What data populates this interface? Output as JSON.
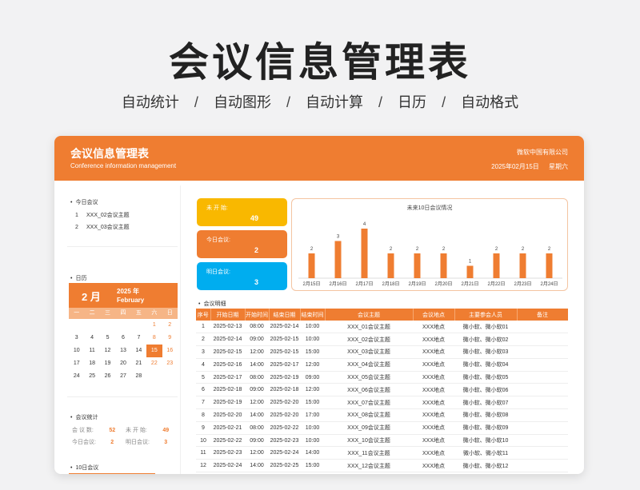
{
  "hero": {
    "title": "会议信息管理表",
    "tags": [
      "自动统计",
      "自动图形",
      "自动计算",
      "日历",
      "自动格式"
    ],
    "separator": "/"
  },
  "header": {
    "title": "会议信息管理表",
    "subtitle": "Conference information management",
    "company": "微软中国有限公司",
    "date": "2025年02月15日",
    "weekday": "星期六"
  },
  "today_meetings": {
    "title": "今日会议",
    "items": [
      {
        "n": "1",
        "name": "XXX_02会议主题"
      },
      {
        "n": "2",
        "name": "XXX_03会议主题"
      }
    ]
  },
  "calendar": {
    "title": "日历",
    "month": "2 月",
    "year": "2025 年",
    "month_en": "February",
    "weekdays": [
      "一",
      "二",
      "三",
      "四",
      "五",
      "六",
      "日"
    ],
    "weeks": [
      [
        "",
        "",
        "",
        "",
        "",
        "1",
        "2"
      ],
      [
        "3",
        "4",
        "5",
        "6",
        "7",
        "8",
        "9"
      ],
      [
        "10",
        "11",
        "12",
        "13",
        "14",
        "15",
        "16"
      ],
      [
        "17",
        "18",
        "19",
        "20",
        "21",
        "22",
        "23"
      ],
      [
        "24",
        "25",
        "26",
        "27",
        "28",
        "",
        ""
      ]
    ],
    "today": "15"
  },
  "stats": {
    "title": "会议统计",
    "total_label": "会 议 数:",
    "total": "52",
    "notstarted_label": "未 开 始:",
    "notstarted": "49",
    "today_label": "今日会议:",
    "today": "2",
    "tomorrow_label": "明日会议:",
    "tomorrow": "3"
  },
  "ten_day_title": "10日会议",
  "kpis": [
    {
      "label": "未 开 始:",
      "value": "49",
      "color": "#f9b800"
    },
    {
      "label": "今日会议:",
      "value": "2",
      "color": "#ef7d31"
    },
    {
      "label": "明日会议:",
      "value": "3",
      "color": "#00adef"
    }
  ],
  "chart_data": {
    "type": "bar",
    "title": "未来10日会议情况",
    "categories": [
      "2月15日",
      "2月16日",
      "2月17日",
      "2月18日",
      "2月19日",
      "2月20日",
      "2月21日",
      "2月22日",
      "2月23日",
      "2月24日"
    ],
    "values": [
      2,
      3,
      4,
      2,
      2,
      2,
      1,
      2,
      2,
      2
    ],
    "color": "#ef7d31",
    "grid": false,
    "legend": "none"
  },
  "detail": {
    "title": "会议明细",
    "columns": [
      "序号",
      "开始日期",
      "开始时间",
      "结束日期",
      "结束时间",
      "会议主题",
      "会议地点",
      "主要参会人员",
      "备注"
    ],
    "rows": [
      [
        "1",
        "2025-02-13",
        "08:00",
        "2025-02-14",
        "10:00",
        "XXX_01会议主题",
        "XXX地点",
        "微小软、微小软01",
        ""
      ],
      [
        "2",
        "2025-02-14",
        "09:00",
        "2025-02-15",
        "10:00",
        "XXX_02会议主题",
        "XXX地点",
        "微小软、微小软02",
        ""
      ],
      [
        "3",
        "2025-02-15",
        "12:00",
        "2025-02-15",
        "15:00",
        "XXX_03会议主题",
        "XXX地点",
        "微小软、微小软03",
        ""
      ],
      [
        "4",
        "2025-02-16",
        "14:00",
        "2025-02-17",
        "12:00",
        "XXX_04会议主题",
        "XXX地点",
        "微小软、微小软04",
        ""
      ],
      [
        "5",
        "2025-02-17",
        "08:00",
        "2025-02-19",
        "09:00",
        "XXX_05会议主题",
        "XXX地点",
        "微小软、微小软05",
        ""
      ],
      [
        "6",
        "2025-02-18",
        "09:00",
        "2025-02-18",
        "12:00",
        "XXX_06会议主题",
        "XXX地点",
        "微小软、微小软06",
        ""
      ],
      [
        "7",
        "2025-02-19",
        "12:00",
        "2025-02-20",
        "15:00",
        "XXX_07会议主题",
        "XXX地点",
        "微小软、微小软07",
        ""
      ],
      [
        "8",
        "2025-02-20",
        "14:00",
        "2025-02-20",
        "17:00",
        "XXX_08会议主题",
        "XXX地点",
        "微小软、微小软08",
        ""
      ],
      [
        "9",
        "2025-02-21",
        "08:00",
        "2025-02-22",
        "10:00",
        "XXX_09会议主题",
        "XXX地点",
        "微小软、微小软09",
        ""
      ],
      [
        "10",
        "2025-02-22",
        "09:00",
        "2025-02-23",
        "10:00",
        "XXX_10会议主题",
        "XXX地点",
        "微小软、微小软10",
        ""
      ],
      [
        "11",
        "2025-02-23",
        "12:00",
        "2025-02-24",
        "14:00",
        "XXX_11会议主题",
        "XXX地点",
        "微小软、微小软11",
        ""
      ],
      [
        "12",
        "2025-02-24",
        "14:00",
        "2025-02-25",
        "15:00",
        "XXX_12会议主题",
        "XXX地点",
        "微小软、微小软12",
        ""
      ]
    ]
  }
}
